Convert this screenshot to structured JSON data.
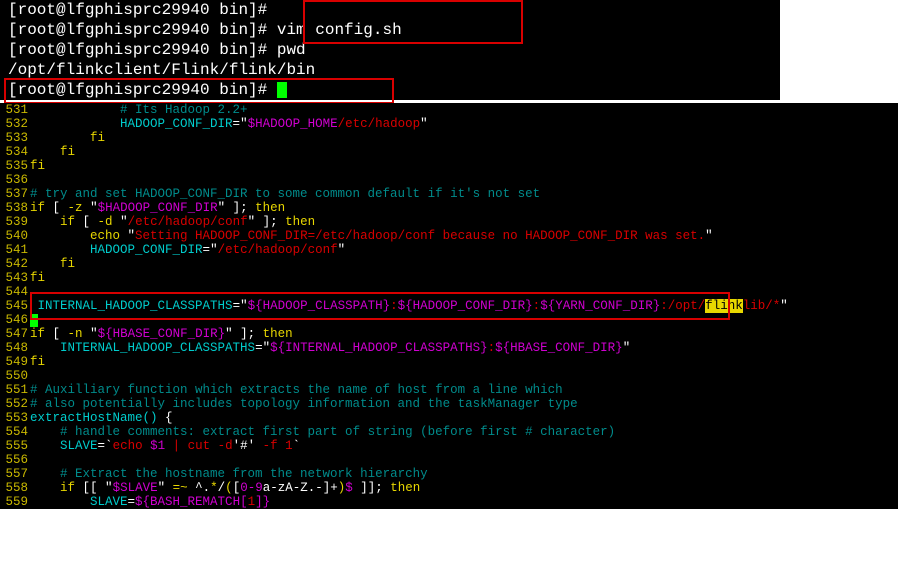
{
  "top": {
    "l1_prompt": "[root@lfgphisprc29940 bin]#",
    "l2_prompt": "[root@lfgphisprc29940 bin]# ",
    "l2_cmd": "vim config.sh",
    "l3_prompt": "[root@lfgphisprc29940 bin]# ",
    "l3_cmd": "pwd",
    "l4_path": "/opt/flinkclient/Flink/flink/bin",
    "l5_prompt": "[root@lfgphisprc29940 bin]# "
  },
  "lines": {
    "531": {
      "indent": "            ",
      "comment": "# Its Hadoop 2.2+"
    },
    "532": {
      "indent": "            ",
      "var": "HADOOP_CONF_DIR",
      "eq": "=",
      "q1": "\"",
      "val1": "$HADOOP_HOME",
      "val2": "/etc/hadoop",
      "q2": "\""
    },
    "533": {
      "indent": "        ",
      "kw": "fi"
    },
    "534": {
      "indent": "    ",
      "kw": "fi"
    },
    "535": {
      "kw": "fi"
    },
    "536": {
      "blank": " "
    },
    "537": {
      "comment": "# try and set HADOOP_CONF_DIR to some common default if it's not set"
    },
    "538": {
      "p1": "if",
      "p2": " [ ",
      "p3": "-z",
      "p4": " ",
      "q1": "\"",
      "val": "$HADOOP_CONF_DIR",
      "q2": "\"",
      "p5": " ]; ",
      "p6": "then"
    },
    "539": {
      "indent": "    ",
      "p1": "if",
      "p2": " [ ",
      "p3": "-d",
      "p4": " ",
      "q1": "\"",
      "val": "/etc/hadoop/conf",
      "q2": "\"",
      "p5": " ]; ",
      "p6": "then"
    },
    "540": {
      "indent": "        ",
      "cmd": "echo ",
      "q1": "\"",
      "str": "Setting HADOOP_CONF_DIR=/etc/hadoop/conf because no HADOOP_CONF_DIR was set.",
      "q2": "\""
    },
    "541": {
      "indent": "        ",
      "var": "HADOOP_CONF_DIR",
      "eq": "=",
      "q1": "\"",
      "val": "/etc/hadoop/conf",
      "q2": "\""
    },
    "542": {
      "indent": "    ",
      "kw": "fi"
    },
    "543": {
      "kw": "fi"
    },
    "544": {
      "blank": " "
    },
    "545": {
      "indent": " ",
      "var": "INTERNAL_HADOOP_CLASSPATHS",
      "eq": "=",
      "q1": "\"",
      "v1": "${HADOOP_CLASSPATH}",
      "c1": ":",
      "v2": "${HADOOP_CONF_DIR}",
      "c2": ":",
      "v3": "${YARN_CONF_DIR}",
      "c3": ":/opt/",
      "hl": "flink",
      "c4": "lib/*",
      "q2": "\""
    },
    "546": {
      "blank2": " "
    },
    "547": {
      "p1": "if",
      "p2": " [ ",
      "p3": "-n",
      "p4": " ",
      "q1": "\"",
      "val": "${HBASE_CONF_DIR}",
      "q2": "\"",
      "p5": " ]; ",
      "p6": "then"
    },
    "548": {
      "indent": "    ",
      "var": "INTERNAL_HADOOP_CLASSPATHS",
      "eq": "=",
      "q1": "\"",
      "v1": "${INTERNAL_HADOOP_CLASSPATHS}",
      "c1": ":",
      "v2": "${HBASE_CONF_DIR}",
      "q2": "\""
    },
    "549": {
      "kw": "fi"
    },
    "550": {
      "blank": " "
    },
    "551": {
      "comment": "# Auxilliary function which extracts the name of host from a line which"
    },
    "552": {
      "comment": "# also potentially includes topology information and the taskManager type"
    },
    "553": {
      "fn": "extractHostName()",
      "brace": " {"
    },
    "554": {
      "indent": "    ",
      "comment": "# handle comments: extract first part of string (before first # character)"
    },
    "555": {
      "indent": "    ",
      "var": "SLAVE",
      "eq": "=",
      "bt1": "`",
      "cmd": "echo ",
      "arg": "$1",
      "pipe": " | cut ",
      "opt": "-d",
      "q1": "'#'",
      "opt2": " -f ",
      "num": "1",
      "bt2": "`"
    },
    "556": {
      "blank": " "
    },
    "557": {
      "indent": "    ",
      "comment": "# Extract the hostname from the network hierarchy"
    },
    "558": {
      "indent": "    ",
      "p1": "if",
      "p2": " [[ ",
      "q1": "\"",
      "val": "$SLAVE",
      "q2": "\"",
      "p3": " ",
      "op": "=~",
      "p4": " ^.",
      "star": "*",
      "p5": "/",
      "paren1": "(",
      "p6": "[",
      "range": "0-9",
      "p7": "a-zA-Z.-]+",
      "paren2": ")",
      "dollar": "$",
      "p8": " ]]; ",
      "p9": "then"
    },
    "559": {
      "indent": "        ",
      "var": "SLAVE",
      "eq": "=",
      "v1": "${BASH_REMATCH[",
      "idx": "1",
      "v2": "]}"
    }
  }
}
